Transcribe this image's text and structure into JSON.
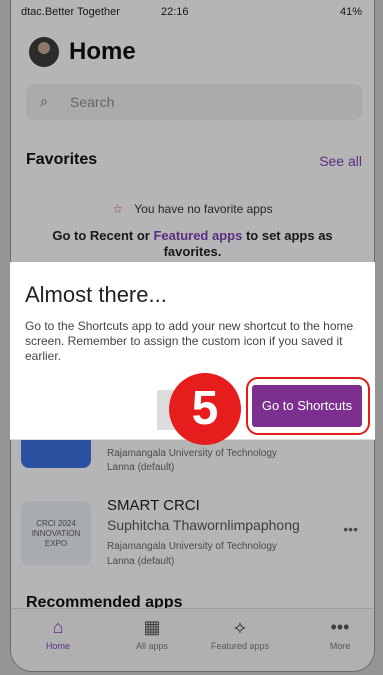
{
  "status_bar": {
    "carrier": "dtac.Better Together",
    "time": "22:16",
    "battery": "41%"
  },
  "header": {
    "title": "Home"
  },
  "search": {
    "placeholder": "Search"
  },
  "favorites": {
    "title": "Favorites",
    "see_all": "See all",
    "empty_text": "You have no favorite apps",
    "hint_prefix": "Go to Recent or",
    "hint_link": "Featured apps",
    "hint_suffix": "to set apps as favorites."
  },
  "dialog": {
    "title": "Almost there...",
    "body": "Go to the Shortcuts app to add your new shortcut to the home screen. Remember to assign the custom icon if you saved it earlier.",
    "primary_button": "Go to Shortcuts",
    "step_badge": "5"
  },
  "apps": [
    {
      "name": "",
      "owner": "",
      "meta1": "Rajamangala University of Technology",
      "meta2": "Lanna (default)"
    },
    {
      "name": "SMART CRCI",
      "owner": "Suphitcha  Thawornlimpaphong",
      "meta1": "Rajamangala University of Technology",
      "meta2": "Lanna (default)",
      "logo_text": "CRCI 2024 INNOVATION EXPO"
    }
  ],
  "recommended": {
    "title": "Recommended apps"
  },
  "bottom_nav": [
    {
      "label": "Home",
      "icon": "home-icon"
    },
    {
      "label": "All apps",
      "icon": "grid-icon"
    },
    {
      "label": "Featured apps",
      "icon": "rocket-icon"
    },
    {
      "label": "More",
      "icon": "more-icon"
    }
  ],
  "colors": {
    "accent": "#7a3fb0",
    "button": "#7d2f8f",
    "highlight": "#e31b1b"
  }
}
